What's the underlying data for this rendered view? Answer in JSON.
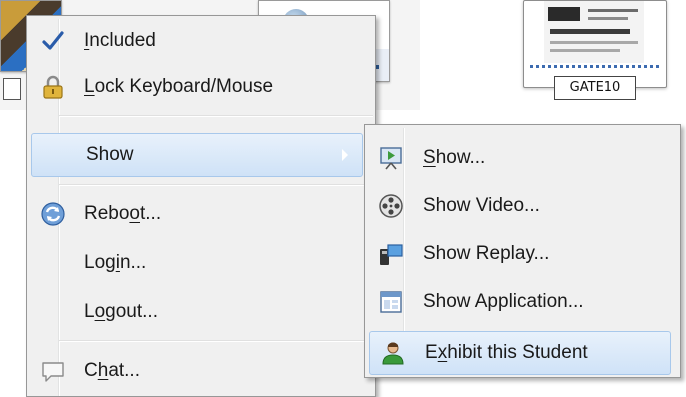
{
  "thumbnails": {
    "gate_label": "GATE10"
  },
  "menu": {
    "items": [
      {
        "id": "included",
        "label": "Included",
        "mnemonic_index": 0,
        "icon": "checkmark-icon"
      },
      {
        "id": "lock",
        "label": "Lock Keyboard/Mouse",
        "mnemonic_index": 0,
        "icon": "padlock-icon"
      },
      {
        "id": "show",
        "label": "Show",
        "highlighted": true,
        "has_submenu": true
      },
      {
        "id": "reboot",
        "label": "Reboot...",
        "mnemonic_index": 4,
        "icon": "reboot-icon"
      },
      {
        "id": "login",
        "label": "Login...",
        "mnemonic_index": 3
      },
      {
        "id": "logout",
        "label": "Logout...",
        "mnemonic_index": 1
      },
      {
        "id": "chat",
        "label": "Chat...",
        "mnemonic_index": 1,
        "icon": "chat-bubble-icon"
      }
    ]
  },
  "submenu": {
    "items": [
      {
        "id": "show",
        "label": "Show...",
        "mnemonic_index": 0,
        "icon": "presentation-icon"
      },
      {
        "id": "show_video",
        "label": "Show Video...",
        "icon": "film-reel-icon"
      },
      {
        "id": "show_replay",
        "label": "Show Replay...",
        "icon": "replay-camera-icon"
      },
      {
        "id": "show_application",
        "label": "Show Application...",
        "icon": "application-window-icon"
      },
      {
        "id": "exhibit",
        "label": "Exhibit this Student",
        "mnemonic_index": 1,
        "highlighted": true,
        "icon": "student-icon"
      }
    ]
  },
  "colors": {
    "highlight": "#cfe2f7",
    "menu_bg": "#f0f0f0",
    "check": "#2a5caa"
  }
}
